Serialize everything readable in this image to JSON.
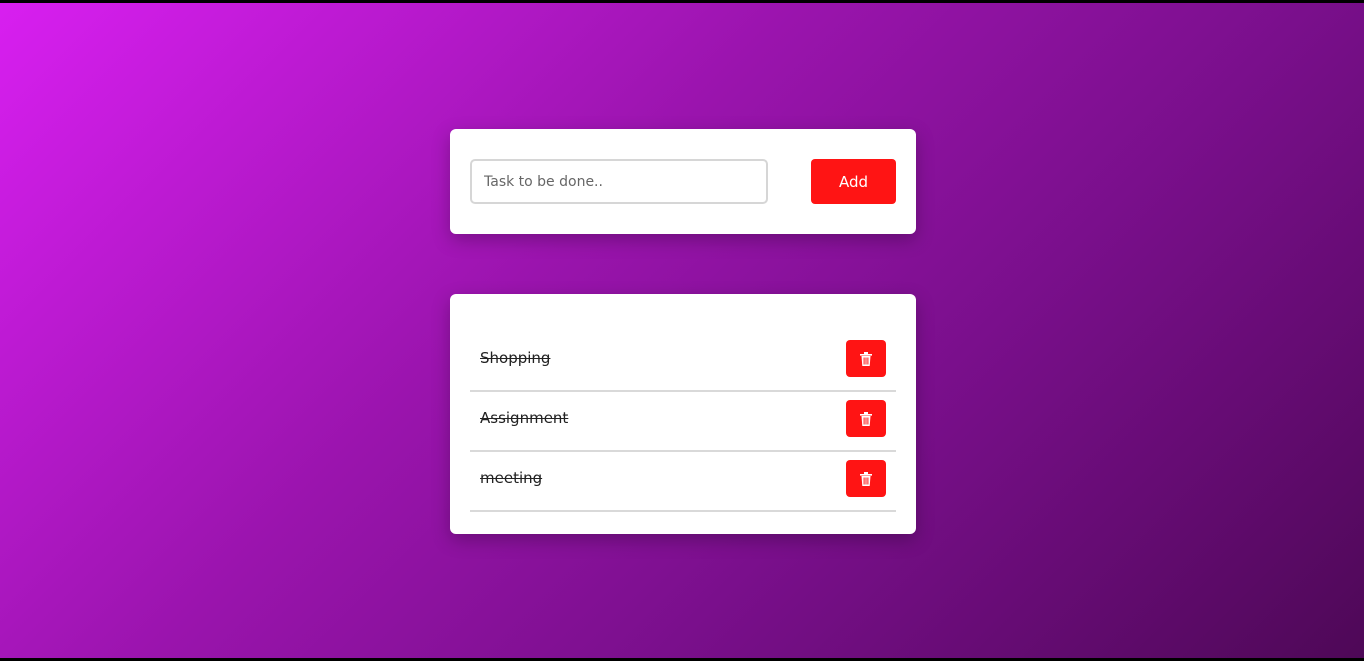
{
  "input_card": {
    "task_input_placeholder": "Task to be done..",
    "task_input_value": "",
    "add_label": "Add"
  },
  "task_list": {
    "items": [
      {
        "label": "Shopping",
        "completed": true,
        "delete_icon": "trash-icon"
      },
      {
        "label": "Assignment",
        "completed": true,
        "delete_icon": "trash-icon"
      },
      {
        "label": "meeting",
        "completed": true,
        "delete_icon": "trash-icon"
      }
    ]
  },
  "colors": {
    "accent": "#ff1414",
    "background_start": "#d81ff0",
    "background_end": "#4e0857",
    "card": "#ffffff"
  }
}
